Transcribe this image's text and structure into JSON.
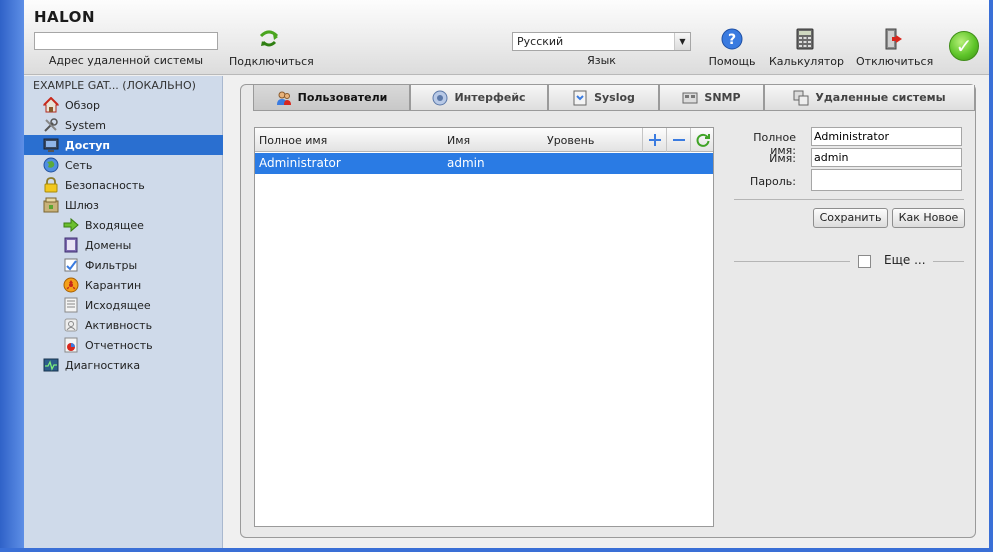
{
  "app": {
    "logo": "HALON"
  },
  "toolbar": {
    "remote_address_value": "",
    "remote_address_label": "Адрес удаленной системы",
    "connect_label": "Подключиться",
    "language_value": "Русский",
    "language_label": "Язык",
    "help_label": "Помощь",
    "calculator_label": "Калькулятор",
    "disconnect_label": "Отключиться"
  },
  "sidebar": {
    "title": "EXAMPLE GAT... (ЛОКАЛЬНО)",
    "items": [
      {
        "label": "Обзор",
        "icon": "home-icon"
      },
      {
        "label": "System",
        "icon": "tools-icon"
      },
      {
        "label": "Доступ",
        "icon": "monitor-icon",
        "active": true
      },
      {
        "label": "Сеть",
        "icon": "globe-icon"
      },
      {
        "label": "Безопасность",
        "icon": "lock-icon"
      },
      {
        "label": "Шлюз",
        "icon": "gateway-icon"
      },
      {
        "label": "Входящее",
        "icon": "incoming-arrow-icon"
      },
      {
        "label": "Домены",
        "icon": "domains-icon"
      },
      {
        "label": "Фильтры",
        "icon": "filters-icon"
      },
      {
        "label": "Карантин",
        "icon": "quarantine-icon"
      },
      {
        "label": "Исходящее",
        "icon": "outgoing-icon"
      },
      {
        "label": "Активность",
        "icon": "activity-icon"
      },
      {
        "label": "Отчетность",
        "icon": "reports-icon"
      },
      {
        "label": "Диагностика",
        "icon": "diagnostics-icon"
      }
    ]
  },
  "tabs": [
    {
      "label": "Пользователи",
      "active": true
    },
    {
      "label": "Интерфейс"
    },
    {
      "label": "Syslog"
    },
    {
      "label": "SNMP"
    },
    {
      "label": "Удаленные системы"
    }
  ],
  "users_table": {
    "columns": [
      "Полное имя",
      "Имя",
      "Уровень"
    ],
    "rows": [
      {
        "full_name": "Administrator",
        "name": "admin",
        "level": ""
      }
    ]
  },
  "form": {
    "full_name_label": "Полное имя:",
    "full_name_value": "Administrator",
    "name_label": "Имя:",
    "name_value": "admin",
    "password_label": "Пароль:",
    "password_value": "",
    "save_label": "Сохранить",
    "save_as_new_label": "Как Новое",
    "more_label": "Еще ..."
  },
  "colors": {
    "selection": "#2a7be4",
    "sidebar_bg": "#cfdaea",
    "status_ok": "#5fc52a"
  }
}
